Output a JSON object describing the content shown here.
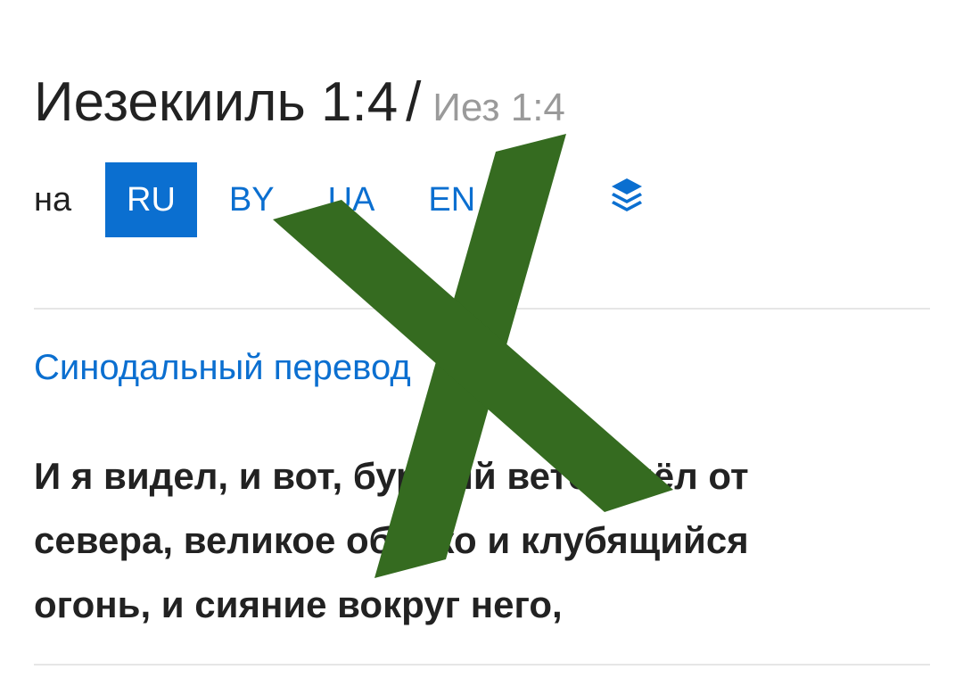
{
  "header": {
    "title": "Иезекииль 1:4",
    "separator": "/",
    "short_ref": "Иез 1:4"
  },
  "languages": {
    "prefix": "на",
    "items": [
      {
        "code": "RU",
        "active": true
      },
      {
        "code": "BY",
        "active": false
      },
      {
        "code": "UA",
        "active": false
      },
      {
        "code": "EN",
        "active": false
      }
    ],
    "layers_icon": "layers-icon"
  },
  "translation": {
    "name": "Синодальный перевод"
  },
  "verse": {
    "text": "И я видел, и вот, бурный ветер шёл от севера, великое облако и клубящийся огонь, и сияние вокруг него,"
  },
  "colors": {
    "accent": "#0b6fd0",
    "text": "#222222",
    "muted": "#9a9a9a",
    "divider": "#e6e6e6",
    "overlay_x": "#356b20"
  }
}
